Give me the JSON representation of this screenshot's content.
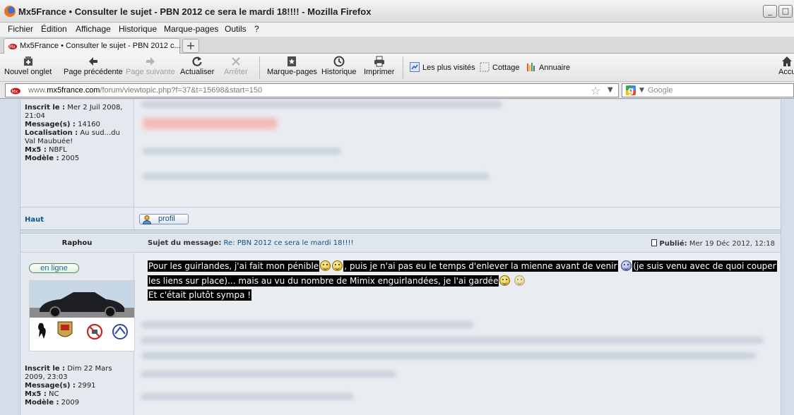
{
  "window": {
    "title": "Mx5France • Consulter le sujet - PBN 2012 ce sera le mardi 18!!!! - Mozilla Firefox",
    "minimize": "_",
    "maximize": "□"
  },
  "menu": [
    "Fichier",
    "Édition",
    "Affichage",
    "Historique",
    "Marque-pages",
    "Outils",
    "?"
  ],
  "tab": {
    "label": "Mx5France • Consulter le sujet - PBN 2012 c...",
    "new_tab_symbol": "+"
  },
  "toolbar": {
    "new_tab": "Nouvel onglet",
    "back": "Page précédente",
    "forward": "Page suivante",
    "reload": "Actualiser",
    "stop": "Arrêter",
    "bookmarks": "Marque-pages",
    "history": "Historique",
    "print": "Imprimer",
    "home": "Accu"
  },
  "bookmarks_bar": [
    "Les plus visités",
    "Cottage",
    "Annuaire"
  ],
  "address": {
    "prefix": "www.",
    "domain": "mx5france.com",
    "path": "/forum/viewtopic.php?f=37&t=15698&start=150",
    "search_placeholder": "Google"
  },
  "post1": {
    "info": {
      "joined_label": "Inscrit le :",
      "joined_value": "Mer 2 Juil 2008, 21:04",
      "messages_label": "Message(s) :",
      "messages_value": "14160",
      "location_label": "Localisation :",
      "location_value": "Au sud...du Val Maubuée!",
      "mx5_label": "Mx5 :",
      "mx5_value": "NBFL",
      "model_label": "Modèle :",
      "model_value": "2005"
    },
    "top_link": "Haut",
    "profile_button": "profil"
  },
  "post2": {
    "author": "Raphou",
    "subject_label": "Sujet du message:",
    "subject_value": "Re: PBN 2012 ce sera le mardi 18!!!!",
    "published_label": "Publié:",
    "published_value": "Mer 19 Déc 2012, 12:18",
    "online_badge": "en ligne",
    "text_line1a": "Pour les guirlandes, j'ai fait mon pénible",
    "text_line1b": ", puis je n'ai pas eu le temps d'enlever la mienne avant de venir",
    "text_line1c": "(je suis venu avec de quoi couper",
    "text_line2a": "les liens sur place)... mais au vu du nombre de Mimix enguirlandées, je l'ai gardée",
    "text_line3": "Et c'était plutôt sympa !",
    "info": {
      "joined_label": "Inscrit le :",
      "joined_value": "Dim 22 Mars 2009, 23:03",
      "messages_label": "Message(s) :",
      "messages_value": "2991",
      "mx5_label": "Mx5 :",
      "mx5_value": "NC",
      "model_label": "Modèle :",
      "model_value": "2009"
    }
  },
  "colors": {
    "link": "#105289",
    "highlight_bg": "#000000",
    "forum_bg": "#e7ecf2"
  },
  "icons": [
    "firefox-icon",
    "new-tab-icon",
    "back-arrow-icon",
    "forward-arrow-icon",
    "reload-icon",
    "stop-icon",
    "bookmarks-icon",
    "history-clock-icon",
    "printer-icon",
    "home-icon",
    "star-icon",
    "google-icon",
    "smiley-icon"
  ]
}
